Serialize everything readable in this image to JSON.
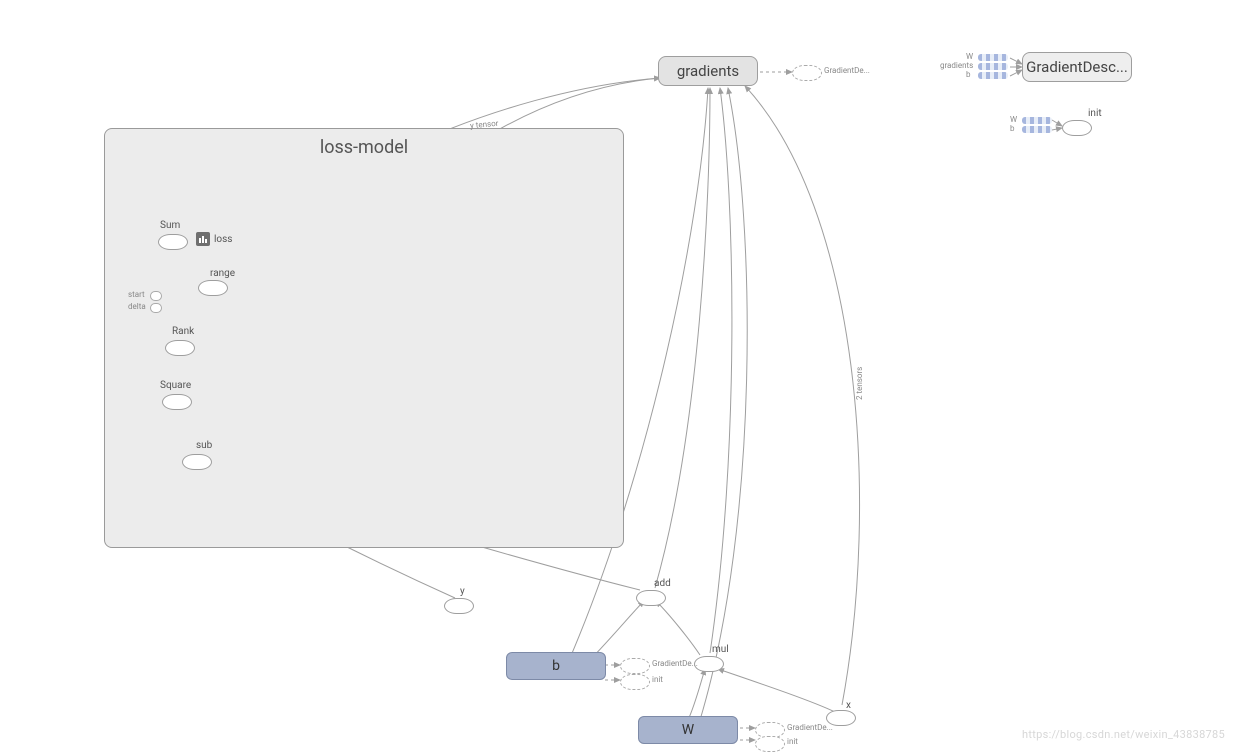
{
  "scope": {
    "title": "loss-model"
  },
  "nodes": {
    "gradients": "gradients",
    "gradientDescent": "GradientDesc...",
    "init": "init",
    "sum": "Sum",
    "loss": "loss",
    "range": "range",
    "start": "start",
    "delta": "delta",
    "rank": "Rank",
    "square": "Square",
    "sub": "sub",
    "y": "y",
    "add": "add",
    "mul": "mul",
    "x": "x",
    "b": "b",
    "W": "W"
  },
  "minilabels": {
    "legendW": "W",
    "legendGradients": "gradients",
    "legendB": "b",
    "gradDe1": "GradientDe...",
    "gradDe2": "GradientDe...",
    "gradDe3": "GradientDe...",
    "initLbl": "init",
    "tensors": "2 tensors",
    "ytensor": "y tensor"
  },
  "watermark": "https://blog.csdn.net/weixin_43838785"
}
